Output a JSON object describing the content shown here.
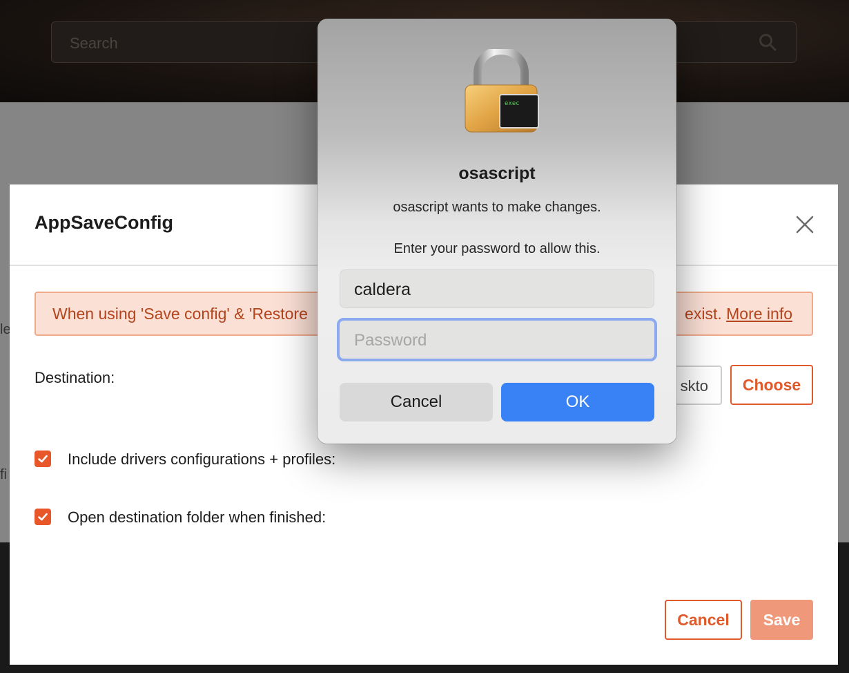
{
  "background": {
    "search_placeholder": "Search",
    "left_fragment_1": "le",
    "left_fragment_2": "fi"
  },
  "modal": {
    "title": "AppSaveConfig",
    "alert": {
      "text_start": "When using 'Save config' & 'Restore",
      "text_end": "exist.",
      "link": "More info"
    },
    "destination": {
      "label": "Destination:",
      "value_fragment": "skto",
      "choose_label": "Choose"
    },
    "options": [
      {
        "label": "Include drivers configurations + profiles:",
        "checked": true
      },
      {
        "label": "Open destination folder when finished:",
        "checked": true
      }
    ],
    "footer": {
      "cancel_label": "Cancel",
      "save_label": "Save"
    }
  },
  "auth_dialog": {
    "icon_badge": "exec",
    "title": "osascript",
    "message": "osascript wants to make changes.",
    "prompt": "Enter your password to allow this.",
    "username": "caldera",
    "password_placeholder": "Password",
    "cancel_label": "Cancel",
    "ok_label": "OK"
  },
  "colors": {
    "accent": "#e0592a",
    "alert_bg": "#fbe0d6",
    "alert_text": "#b4441c",
    "mac_blue": "#3882f5",
    "focus_ring": "#8aa9ee"
  }
}
